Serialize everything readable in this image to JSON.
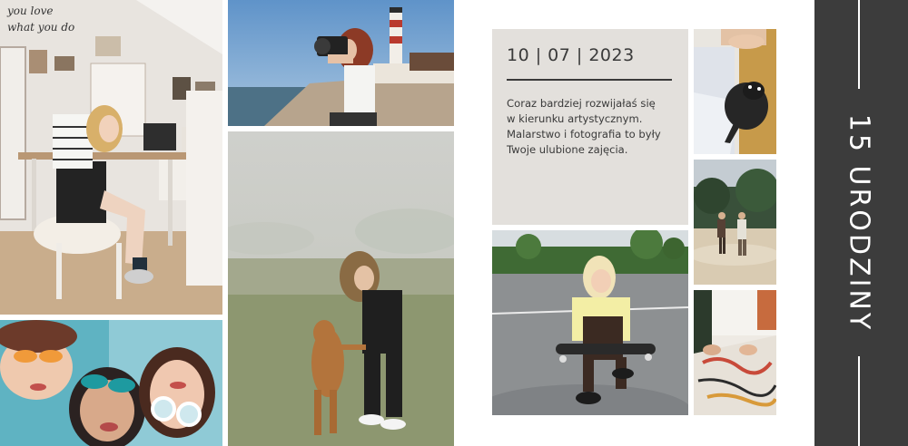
{
  "card": {
    "date": "10 | 07 | 2023",
    "caption_lines": [
      "Coraz bardziej rozwijałaś się",
      "w kierunku artystycznym.",
      "Malarstwo i fotografia to były",
      "Twoje ulubione zajęcia."
    ],
    "title": "15 URODZINY"
  },
  "wall_lettering": [
    "you love",
    "what you do"
  ],
  "photos": [
    {
      "name": "photo-girl-at-desk"
    },
    {
      "name": "photo-girl-with-camera"
    },
    {
      "name": "photo-girls-sunglasses"
    },
    {
      "name": "photo-girl-with-dog"
    },
    {
      "name": "photo-girl-skateboard"
    },
    {
      "name": "photo-puppy"
    },
    {
      "name": "photo-couple-beach"
    },
    {
      "name": "photo-painting-hands"
    }
  ],
  "colors": {
    "band": "#3c3c3c",
    "text_panel": "#e3e0dc",
    "text": "#3a3a3a"
  }
}
